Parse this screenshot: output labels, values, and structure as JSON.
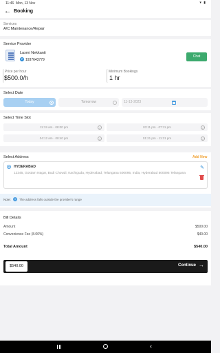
{
  "status_bar": {
    "time": "11:46",
    "date": "Mon, 13 Nov",
    "icons": "▾ ▮"
  },
  "header": {
    "title": "Booking",
    "back_icon": "back-arrow-icon"
  },
  "services": {
    "label": "Services",
    "value": "A/C Maintenance/Repair"
  },
  "service_provider": {
    "section_title": "Service Provider",
    "name": "Laxmi Nekkanti",
    "phone": "1937643779",
    "chat_label": "Chat"
  },
  "price": {
    "label": "Price per hour",
    "value": "$500.0/h"
  },
  "bookings": {
    "label": "Minimum Bookings",
    "value": "1 hr"
  },
  "date": {
    "section_title": "Select Date",
    "today_label": "Today",
    "tomorrow_label": "Tomorrow",
    "picker_value": "11-13-2023"
  },
  "time_slots": {
    "section_title": "Select Time Slot",
    "slots": [
      "11:19 am - 08:00 pm",
      "03:11 pm - 07:11 pm",
      "04:12 am - 08:40 pm",
      "01:21 pm - 11:31 pm"
    ]
  },
  "address": {
    "section_title": "Select Address",
    "add_new_label": "Add New",
    "name": "HYDERABAD",
    "full_text": "12345, Gostam Nagar, Budi Chowdi, Kachiguda, Hyderabad, Telangana 500095, India,  Hyderabad 500095 Telangana"
  },
  "note": {
    "label": "Note:",
    "text": "The address falls outside the provider's range"
  },
  "bill": {
    "section_title": "Bill Details",
    "rows": [
      {
        "label": "Amount",
        "value": "$500.00"
      },
      {
        "label": "Convenience Fee (8.00%)",
        "value": "$40.00"
      }
    ],
    "total_label": "Total Amount",
    "total_value": "$540.00"
  },
  "continue": {
    "price": "$540.00",
    "label": "Continue"
  },
  "colors": {
    "accent_blue": "#4a9de0",
    "chat_green": "#3daa6e",
    "add_new_orange": "#f0a030",
    "delete_red": "#e04a4a",
    "continue_bg": "#1a1a1a"
  }
}
